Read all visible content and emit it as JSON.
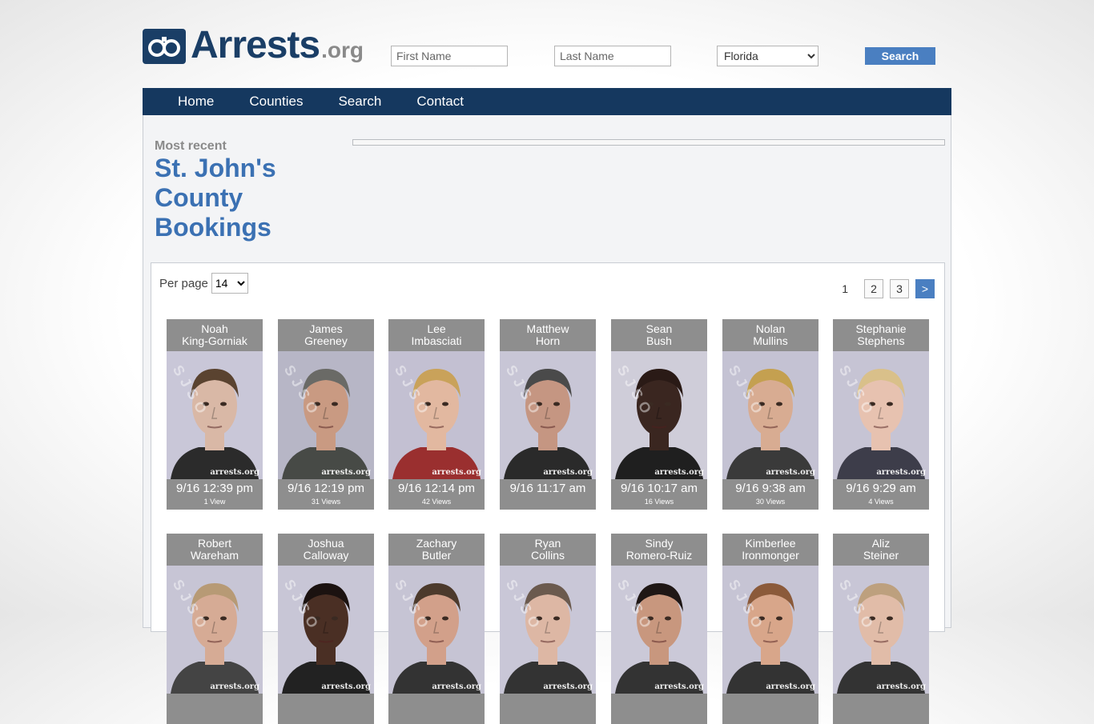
{
  "logo": {
    "main": "Arrests",
    "tld": ".org"
  },
  "search": {
    "first_placeholder": "First Name",
    "last_placeholder": "Last Name",
    "state_selected": "Florida",
    "button_label": "Search"
  },
  "nav": {
    "items": [
      "Home",
      "Counties",
      "Search",
      "Contact"
    ]
  },
  "heading": {
    "most_recent": "Most recent",
    "title": "St. John's County Bookings"
  },
  "listing": {
    "per_page_label": "Per page",
    "per_page_value": "14",
    "pager": {
      "current": "1",
      "pages": [
        "2",
        "3"
      ],
      "next": ">"
    }
  },
  "watermark": "arrests.org",
  "stamp": "SJSO",
  "bookings": [
    {
      "first": "Noah",
      "last": "King-Gorniak",
      "time": "9/16 12:39 pm",
      "views": "1 View",
      "skin": "#d9b8a6",
      "hair": "#5a4330",
      "bg": "#c9c7d8",
      "shirt": "#2b2b2b"
    },
    {
      "first": "James",
      "last": "Greeney",
      "time": "9/16 12:19 pm",
      "views": "31 Views",
      "skin": "#c99a82",
      "hair": "#6a6a66",
      "bg": "#b7b6c6",
      "shirt": "#474a46"
    },
    {
      "first": "Lee",
      "last": "Imbasciati",
      "time": "9/16 12:14 pm",
      "views": "42 Views",
      "skin": "#e2b8a0",
      "hair": "#c9a25a",
      "bg": "#c3c0d2",
      "shirt": "#9a2f2f"
    },
    {
      "first": "Matthew",
      "last": "Horn",
      "time": "9/16 11:17 am",
      "views": "",
      "skin": "#c59682",
      "hair": "#4a4a4a",
      "bg": "#c8c6d6",
      "shirt": "#2a2a2a"
    },
    {
      "first": "Sean",
      "last": "Bush",
      "time": "9/16 10:17 am",
      "views": "16 Views",
      "skin": "#3a2620",
      "hair": "#2a1a16",
      "bg": "#cfcdd9",
      "shirt": "#1f1f1f"
    },
    {
      "first": "Nolan",
      "last": "Mullins",
      "time": "9/16 9:38 am",
      "views": "30 Views",
      "skin": "#d8ac92",
      "hair": "#c4a050",
      "bg": "#c4c2d3",
      "shirt": "#3a3a3a"
    },
    {
      "first": "Stephanie",
      "last": "Stephens",
      "time": "9/16 9:29 am",
      "views": "4 Views",
      "skin": "#e7c2b0",
      "hair": "#d9c08a",
      "bg": "#c6c4d4",
      "shirt": "#3d3d4a"
    },
    {
      "first": "Robert",
      "last": "Wareham",
      "time": "",
      "views": "",
      "skin": "#d6ab95",
      "hair": "#b79a75",
      "bg": "#c7c5d5",
      "shirt": "#444"
    },
    {
      "first": "Joshua",
      "last": "Calloway",
      "time": "",
      "views": "",
      "skin": "#4a2f24",
      "hair": "#1b1210",
      "bg": "#c8c6d6",
      "shirt": "#222"
    },
    {
      "first": "Zachary",
      "last": "Butler",
      "time": "",
      "views": "",
      "skin": "#d2a08a",
      "hair": "#4c3a2c",
      "bg": "#c6c4d4",
      "shirt": "#333"
    },
    {
      "first": "Ryan",
      "last": "Collins",
      "time": "",
      "views": "",
      "skin": "#ddb7a4",
      "hair": "#6b5a4e",
      "bg": "#c9c7d7",
      "shirt": "#333"
    },
    {
      "first": "Sindy",
      "last": "Romero-Ruiz",
      "time": "",
      "views": "",
      "skin": "#c8977e",
      "hair": "#1f1715",
      "bg": "#cbc9d8",
      "shirt": "#333"
    },
    {
      "first": "Kimberlee",
      "last": "Ironmonger",
      "time": "",
      "views": "",
      "skin": "#d8a68a",
      "hair": "#8b5a3a",
      "bg": "#c6c4d4",
      "shirt": "#333"
    },
    {
      "first": "Aliz",
      "last": "Steiner",
      "time": "",
      "views": "",
      "skin": "#e1bca8",
      "hair": "#bda07e",
      "bg": "#c8c6d6",
      "shirt": "#333"
    }
  ]
}
